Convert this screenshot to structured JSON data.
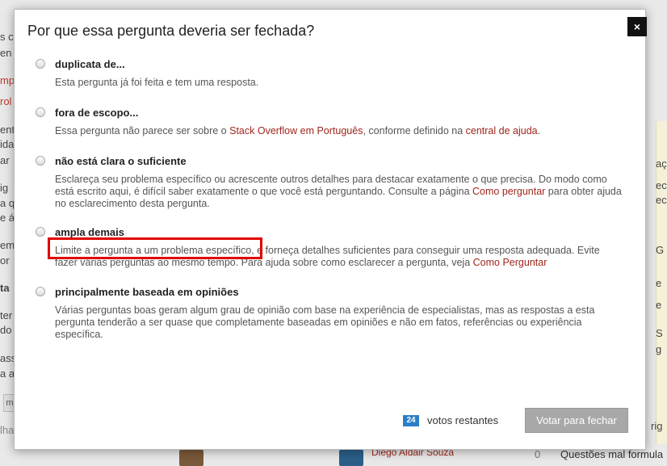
{
  "background": {
    "left_fragments": [
      "s c",
      "en",
      "mpi",
      "rol",
      "ent",
      "ida",
      "ar",
      "ig",
      "a q",
      "e á",
      "em",
      "or",
      "ta",
      "ter",
      "do",
      "ass",
      "a a",
      "lha"
    ],
    "right_fragments": [
      "aç",
      "ec",
      "ec",
      "G",
      "e",
      "e",
      "S",
      "g",
      "rig"
    ],
    "bottom_left_text": "Questões mal formula",
    "bottom_count": "0",
    "bottom_name": "Diego Aldair Souza"
  },
  "modal": {
    "title": "Por que essa pergunta deveria ser fechada?",
    "close_label": "×",
    "options": [
      {
        "label": "duplicata de...",
        "description": "Esta pergunta já foi feita e tem uma resposta."
      },
      {
        "label": "fora de escopo...",
        "desc_before": "Essa pergunta não parece ser sobre o ",
        "desc_link1": "Stack Overflow em Português",
        "desc_middle": ", conforme definido na ",
        "desc_link2": "central de ajuda",
        "desc_after": "."
      },
      {
        "label": "não está clara o suficiente",
        "desc_before": "Esclareça seu problema específico ou acrescente outros detalhes para destacar exatamente o que precisa. Do modo como está escrito aqui, é difícil saber exatamente o que você está perguntando. Consulte a página ",
        "desc_link1": "Como perguntar",
        "desc_after": " para obter ajuda no esclarecimento desta pergunta."
      },
      {
        "label": "ampla demais",
        "desc_before": "Limite a pergunta a um problema específico, e forneça detalhes suficientes para conseguir uma resposta adequada. Evite fazer várias perguntas ao mesmo tempo. Para ajuda sobre como esclarecer a pergunta, veja ",
        "desc_link1": "Como Perguntar"
      },
      {
        "label": "principalmente baseada em opiniões",
        "description": "Várias perguntas boas geram algum grau de opinião com base na experiência de especialistas, mas as respostas a esta pergunta tenderão a ser quase que completamente baseadas em opiniões e não em fatos, referências ou experiência específica."
      }
    ],
    "votes_count": "24",
    "votes_label": "votos restantes",
    "submit_label": "Votar para fechar"
  },
  "colors": {
    "link": "#a0261c",
    "badge": "#2a7fc8",
    "highlight": "#e00000",
    "button_disabled": "#a8a8a8"
  }
}
